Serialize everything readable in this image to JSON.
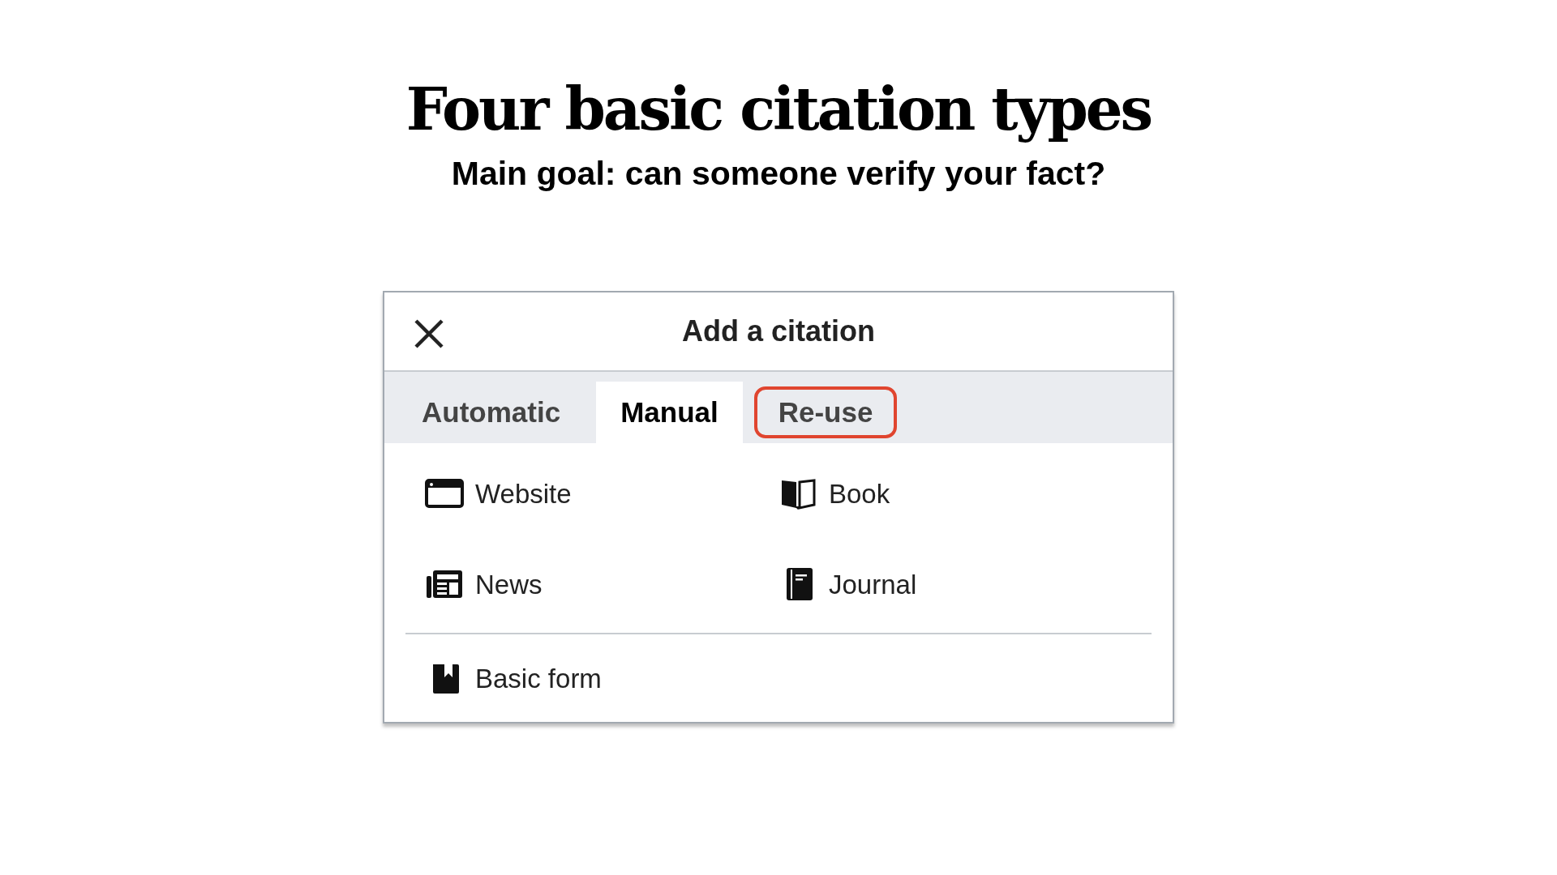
{
  "slide": {
    "title": "Four basic citation types",
    "subtitle": "Main goal: can someone verify your fact?"
  },
  "dialog": {
    "title": "Add a citation",
    "tabs": [
      {
        "label": "Automatic",
        "selected": false,
        "highlighted": false
      },
      {
        "label": "Manual",
        "selected": true,
        "highlighted": false
      },
      {
        "label": "Re-use",
        "selected": false,
        "highlighted": true
      }
    ],
    "items": [
      {
        "kind": "website",
        "label": "Website"
      },
      {
        "kind": "book",
        "label": "Book"
      },
      {
        "kind": "news",
        "label": "News"
      },
      {
        "kind": "journal",
        "label": "Journal"
      }
    ],
    "basic_items": [
      {
        "kind": "basic",
        "label": "Basic form"
      }
    ]
  }
}
